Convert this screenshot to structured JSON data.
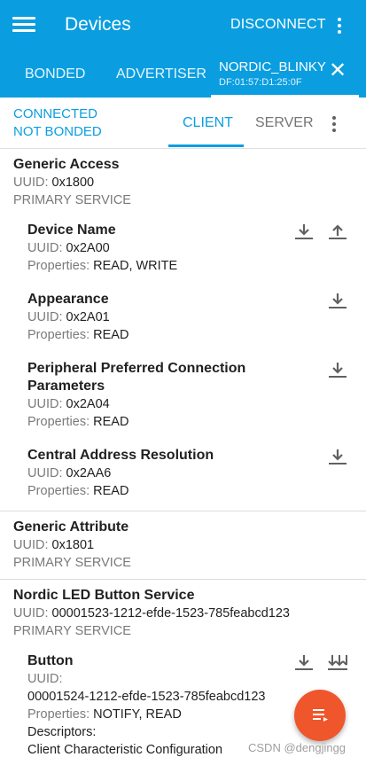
{
  "appbar": {
    "title": "Devices",
    "disconnect": "DISCONNECT"
  },
  "tabs": {
    "bonded": "BONDED",
    "advertiser": "ADVERTISER",
    "device_name": "NORDIC_BLINKY",
    "device_address": "DF:01:57:D1:25:0F"
  },
  "status": {
    "connection": "CONNECTED",
    "bond": "NOT BONDED",
    "client_tab": "CLIENT",
    "server_tab": "SERVER"
  },
  "services": [
    {
      "name": "Generic Access",
      "uuid_label": "UUID:",
      "uuid": "0x1800",
      "type": "PRIMARY SERVICE",
      "characteristics": [
        {
          "name": "Device Name",
          "uuid_label": "UUID:",
          "uuid": "0x2A00",
          "props_label": "Properties:",
          "props": "READ, WRITE"
        },
        {
          "name": "Appearance",
          "uuid_label": "UUID:",
          "uuid": "0x2A01",
          "props_label": "Properties:",
          "props": "READ"
        },
        {
          "name": "Peripheral Preferred Connection Parameters",
          "uuid_label": "UUID:",
          "uuid": "0x2A04",
          "props_label": "Properties:",
          "props": "READ"
        },
        {
          "name": "Central Address Resolution",
          "uuid_label": "UUID:",
          "uuid": "0x2AA6",
          "props_label": "Properties:",
          "props": "READ"
        }
      ]
    },
    {
      "name": "Generic Attribute",
      "uuid_label": "UUID:",
      "uuid": "0x1801",
      "type": "PRIMARY SERVICE"
    },
    {
      "name": "Nordic LED Button Service",
      "uuid_label": "UUID:",
      "uuid": "00001523-1212-efde-1523-785feabcd123",
      "type": "PRIMARY SERVICE",
      "characteristics": [
        {
          "name": "Button",
          "uuid_label": "UUID:",
          "uuid": "00001524-1212-efde-1523-785feabcd123",
          "props_label": "Properties:",
          "props": "NOTIFY, READ",
          "descriptors_label": "Descriptors:",
          "descriptor": "Client Characteristic Configuration"
        }
      ]
    }
  ],
  "watermark": "CSDN @dengjingg",
  "colors": {
    "primary": "#0a9ee0",
    "fab": "#f0562b"
  }
}
